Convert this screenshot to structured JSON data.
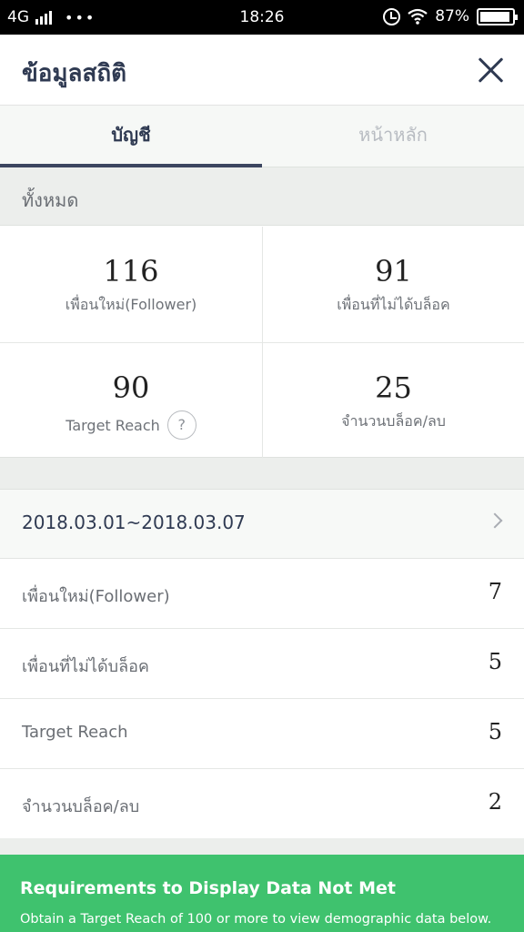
{
  "status_bar": {
    "network": "4G",
    "dots": "•••",
    "time": "18:26",
    "battery": "87%"
  },
  "header": {
    "title": "ข้อมูลสถิติ"
  },
  "tabs": [
    {
      "label": "บัญชี",
      "active": true
    },
    {
      "label": "หน้าหลัก",
      "active": false
    }
  ],
  "section": {
    "label": "ทั้งหมด"
  },
  "stats": [
    {
      "value": "116",
      "label": "เพื่อนใหม่(Follower)"
    },
    {
      "value": "91",
      "label": "เพื่อนที่ไม่ได้บล็อค"
    },
    {
      "value": "90",
      "label": "Target Reach",
      "help": "?"
    },
    {
      "value": "25",
      "label": "จำนวนบล็อค/ลบ"
    }
  ],
  "period": {
    "range": "2018.03.01~2018.03.07"
  },
  "period_rows": [
    {
      "label": "เพื่อนใหม่(Follower)",
      "value": "7"
    },
    {
      "label": "เพื่อนที่ไม่ได้บล็อค",
      "value": "5"
    },
    {
      "label": "Target Reach",
      "value": "5"
    },
    {
      "label": "จำนวนบล็อค/ลบ",
      "value": "2"
    }
  ],
  "banner": {
    "title": "Requirements to Display Data Not Met",
    "text": "Obtain a Target Reach of 100 or more to view demographic data below."
  },
  "colors": {
    "primary": "#2f3a52",
    "banner": "#3fc26e",
    "background": "#eceeec"
  },
  "icons": [
    "signal-icon",
    "alarm-icon",
    "wifi-icon",
    "battery-icon",
    "close-icon",
    "help-icon",
    "chevron-right-icon"
  ]
}
